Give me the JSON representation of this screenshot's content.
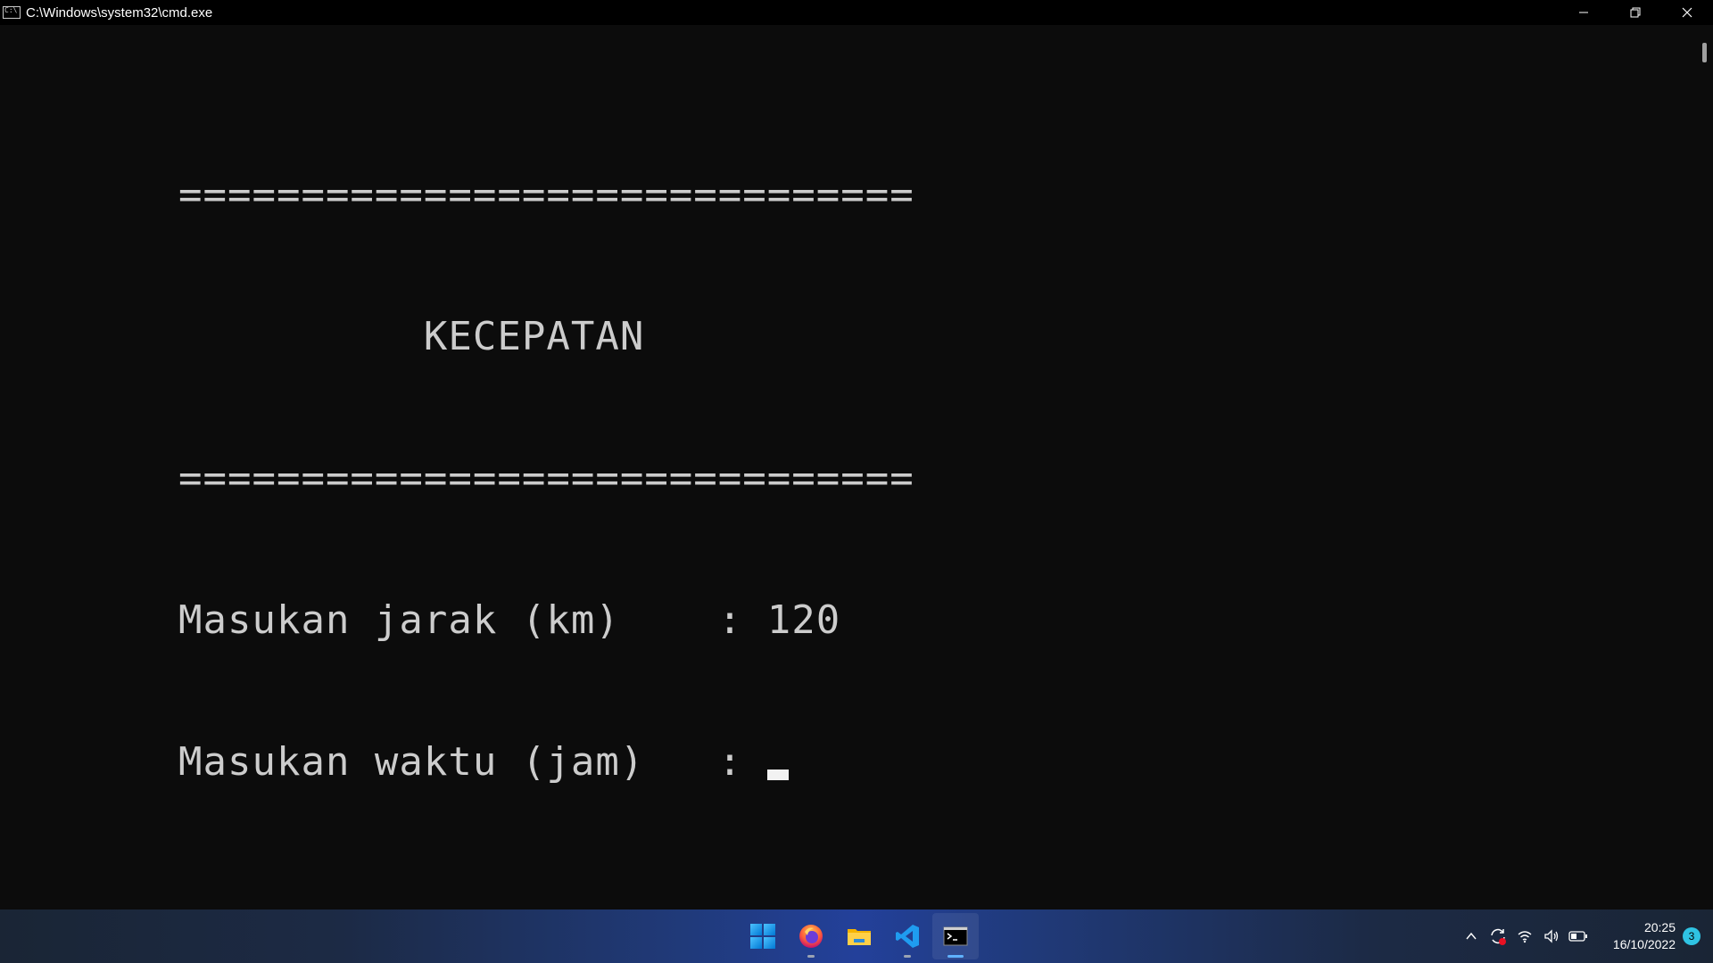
{
  "window": {
    "title": "C:\\Windows\\system32\\cmd.exe",
    "minimize_icon": "minimize-icon",
    "restore_icon": "restore-icon",
    "close_icon": "close-icon"
  },
  "console": {
    "lines": [
      "==============================",
      "          KECEPATAN",
      "==============================",
      "Masukan jarak (km)    : 120",
      "Masukan waktu (jam)   : "
    ],
    "cursor": "block-cursor"
  },
  "taskbar": {
    "apps": [
      {
        "name": "Start",
        "icon": "windows-start-icon"
      },
      {
        "name": "Firefox",
        "icon": "firefox-icon"
      },
      {
        "name": "File Explorer",
        "icon": "folder-icon"
      },
      {
        "name": "Visual Studio Code",
        "icon": "vscode-icon"
      },
      {
        "name": "Command Prompt",
        "icon": "terminal-icon"
      }
    ],
    "tray": {
      "time": "20:25",
      "date": "16/10/2022",
      "notifications": "3"
    }
  },
  "colors": {
    "console_bg": "#0c0c0c",
    "console_text": "#cccccc",
    "titlebar_bg": "#000000",
    "accent": "#5fb2ff"
  }
}
